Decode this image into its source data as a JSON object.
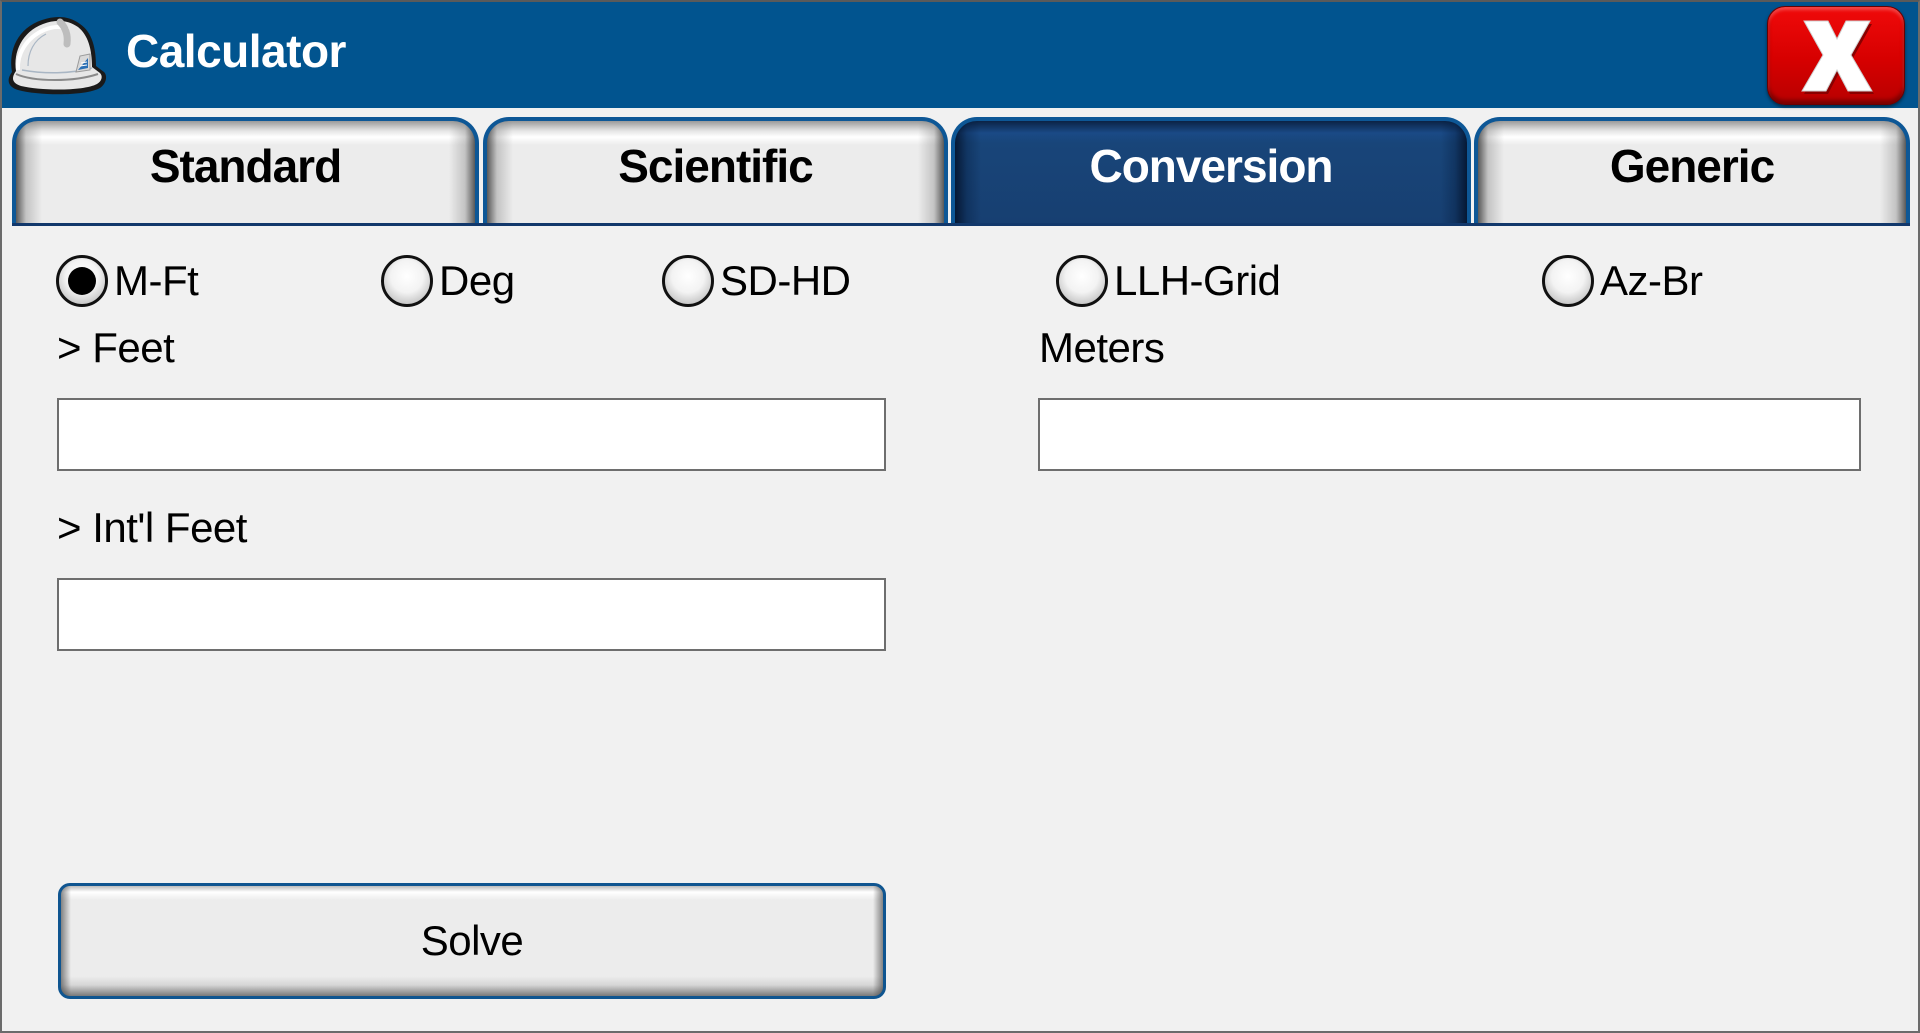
{
  "window": {
    "title": "Calculator",
    "app_icon": "hard-hat-icon",
    "close_icon": "close-x-icon",
    "colors": {
      "titlebar": "#01548f",
      "close_button": "#d60000",
      "active_tab": "#173f71",
      "tab_border": "#0d5796"
    }
  },
  "tabs": [
    {
      "label": "Standard",
      "active": false
    },
    {
      "label": "Scientific",
      "active": false
    },
    {
      "label": "Conversion",
      "active": true
    },
    {
      "label": "Generic",
      "active": false
    }
  ],
  "conversion": {
    "modes": [
      {
        "label": "M-Ft",
        "checked": true
      },
      {
        "label": "Deg",
        "checked": false
      },
      {
        "label": "SD-HD",
        "checked": false
      },
      {
        "label": "LLH-Grid",
        "checked": false
      },
      {
        "label": "Az-Br",
        "checked": false
      }
    ],
    "fields": {
      "feet": {
        "label": "> Feet",
        "value": ""
      },
      "intl_feet": {
        "label": "> Int'l Feet",
        "value": ""
      },
      "meters": {
        "label": "Meters",
        "value": ""
      }
    },
    "solve_label": "Solve"
  }
}
